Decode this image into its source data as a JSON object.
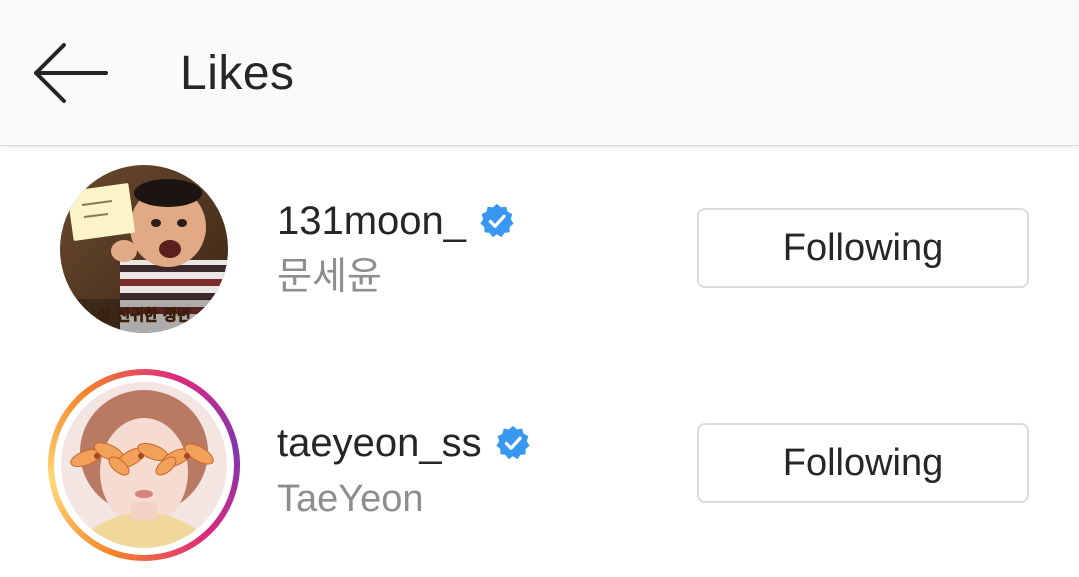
{
  "header": {
    "title": "Likes",
    "back_icon": "arrow-left-icon"
  },
  "likes": [
    {
      "username": "131moon_",
      "full_name": "문세윤",
      "verified": true,
      "has_story_ring": false,
      "button_label": "Following",
      "avatar_caption": "상 진귀한 정면"
    },
    {
      "username": "taeyeon_ss",
      "full_name": "TaeYeon",
      "verified": true,
      "has_story_ring": true,
      "button_label": "Following"
    }
  ],
  "colors": {
    "verified_blue": "#3897f0",
    "header_bg": "#fafafa",
    "secondary_text": "#8e8e8e",
    "button_border": "#dbdbdb",
    "story_ring": [
      "#f58529",
      "#dd2a7b",
      "#8134af"
    ]
  }
}
